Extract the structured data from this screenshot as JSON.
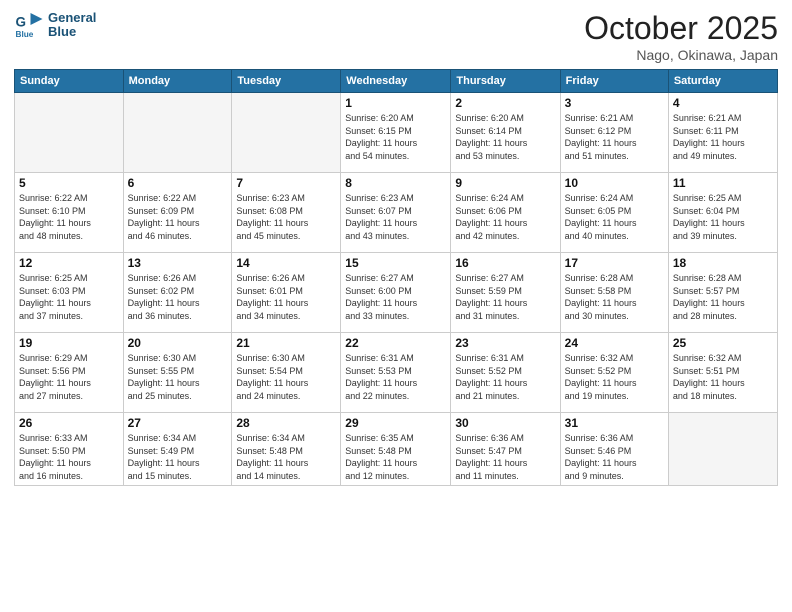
{
  "header": {
    "logo_line1": "General",
    "logo_line2": "Blue",
    "month": "October 2025",
    "location": "Nago, Okinawa, Japan"
  },
  "weekdays": [
    "Sunday",
    "Monday",
    "Tuesday",
    "Wednesday",
    "Thursday",
    "Friday",
    "Saturday"
  ],
  "weeks": [
    [
      {
        "day": "",
        "info": ""
      },
      {
        "day": "",
        "info": ""
      },
      {
        "day": "",
        "info": ""
      },
      {
        "day": "1",
        "info": "Sunrise: 6:20 AM\nSunset: 6:15 PM\nDaylight: 11 hours\nand 54 minutes."
      },
      {
        "day": "2",
        "info": "Sunrise: 6:20 AM\nSunset: 6:14 PM\nDaylight: 11 hours\nand 53 minutes."
      },
      {
        "day": "3",
        "info": "Sunrise: 6:21 AM\nSunset: 6:12 PM\nDaylight: 11 hours\nand 51 minutes."
      },
      {
        "day": "4",
        "info": "Sunrise: 6:21 AM\nSunset: 6:11 PM\nDaylight: 11 hours\nand 49 minutes."
      }
    ],
    [
      {
        "day": "5",
        "info": "Sunrise: 6:22 AM\nSunset: 6:10 PM\nDaylight: 11 hours\nand 48 minutes."
      },
      {
        "day": "6",
        "info": "Sunrise: 6:22 AM\nSunset: 6:09 PM\nDaylight: 11 hours\nand 46 minutes."
      },
      {
        "day": "7",
        "info": "Sunrise: 6:23 AM\nSunset: 6:08 PM\nDaylight: 11 hours\nand 45 minutes."
      },
      {
        "day": "8",
        "info": "Sunrise: 6:23 AM\nSunset: 6:07 PM\nDaylight: 11 hours\nand 43 minutes."
      },
      {
        "day": "9",
        "info": "Sunrise: 6:24 AM\nSunset: 6:06 PM\nDaylight: 11 hours\nand 42 minutes."
      },
      {
        "day": "10",
        "info": "Sunrise: 6:24 AM\nSunset: 6:05 PM\nDaylight: 11 hours\nand 40 minutes."
      },
      {
        "day": "11",
        "info": "Sunrise: 6:25 AM\nSunset: 6:04 PM\nDaylight: 11 hours\nand 39 minutes."
      }
    ],
    [
      {
        "day": "12",
        "info": "Sunrise: 6:25 AM\nSunset: 6:03 PM\nDaylight: 11 hours\nand 37 minutes."
      },
      {
        "day": "13",
        "info": "Sunrise: 6:26 AM\nSunset: 6:02 PM\nDaylight: 11 hours\nand 36 minutes."
      },
      {
        "day": "14",
        "info": "Sunrise: 6:26 AM\nSunset: 6:01 PM\nDaylight: 11 hours\nand 34 minutes."
      },
      {
        "day": "15",
        "info": "Sunrise: 6:27 AM\nSunset: 6:00 PM\nDaylight: 11 hours\nand 33 minutes."
      },
      {
        "day": "16",
        "info": "Sunrise: 6:27 AM\nSunset: 5:59 PM\nDaylight: 11 hours\nand 31 minutes."
      },
      {
        "day": "17",
        "info": "Sunrise: 6:28 AM\nSunset: 5:58 PM\nDaylight: 11 hours\nand 30 minutes."
      },
      {
        "day": "18",
        "info": "Sunrise: 6:28 AM\nSunset: 5:57 PM\nDaylight: 11 hours\nand 28 minutes."
      }
    ],
    [
      {
        "day": "19",
        "info": "Sunrise: 6:29 AM\nSunset: 5:56 PM\nDaylight: 11 hours\nand 27 minutes."
      },
      {
        "day": "20",
        "info": "Sunrise: 6:30 AM\nSunset: 5:55 PM\nDaylight: 11 hours\nand 25 minutes."
      },
      {
        "day": "21",
        "info": "Sunrise: 6:30 AM\nSunset: 5:54 PM\nDaylight: 11 hours\nand 24 minutes."
      },
      {
        "day": "22",
        "info": "Sunrise: 6:31 AM\nSunset: 5:53 PM\nDaylight: 11 hours\nand 22 minutes."
      },
      {
        "day": "23",
        "info": "Sunrise: 6:31 AM\nSunset: 5:52 PM\nDaylight: 11 hours\nand 21 minutes."
      },
      {
        "day": "24",
        "info": "Sunrise: 6:32 AM\nSunset: 5:52 PM\nDaylight: 11 hours\nand 19 minutes."
      },
      {
        "day": "25",
        "info": "Sunrise: 6:32 AM\nSunset: 5:51 PM\nDaylight: 11 hours\nand 18 minutes."
      }
    ],
    [
      {
        "day": "26",
        "info": "Sunrise: 6:33 AM\nSunset: 5:50 PM\nDaylight: 11 hours\nand 16 minutes."
      },
      {
        "day": "27",
        "info": "Sunrise: 6:34 AM\nSunset: 5:49 PM\nDaylight: 11 hours\nand 15 minutes."
      },
      {
        "day": "28",
        "info": "Sunrise: 6:34 AM\nSunset: 5:48 PM\nDaylight: 11 hours\nand 14 minutes."
      },
      {
        "day": "29",
        "info": "Sunrise: 6:35 AM\nSunset: 5:48 PM\nDaylight: 11 hours\nand 12 minutes."
      },
      {
        "day": "30",
        "info": "Sunrise: 6:36 AM\nSunset: 5:47 PM\nDaylight: 11 hours\nand 11 minutes."
      },
      {
        "day": "31",
        "info": "Sunrise: 6:36 AM\nSunset: 5:46 PM\nDaylight: 11 hours\nand 9 minutes."
      },
      {
        "day": "",
        "info": ""
      }
    ]
  ]
}
